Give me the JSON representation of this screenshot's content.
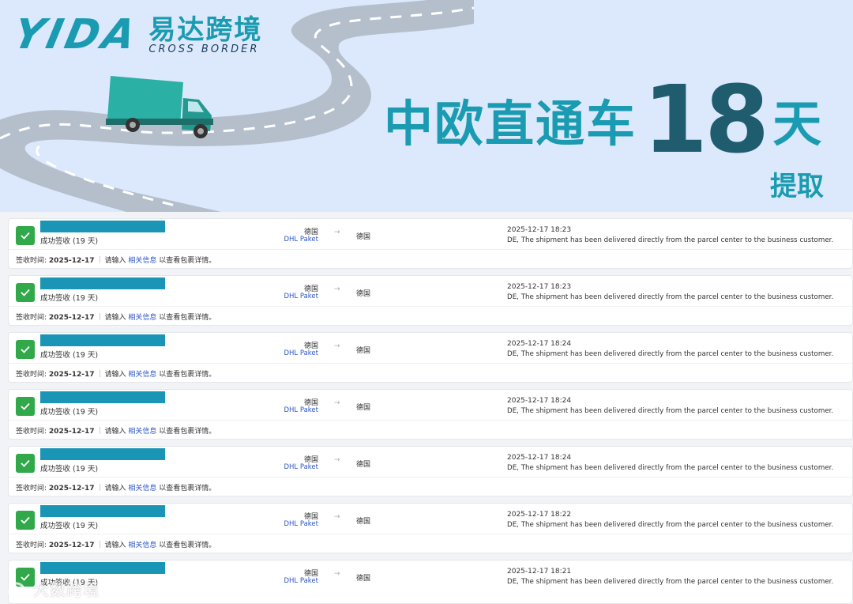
{
  "banner": {
    "logo_en": "YIDA",
    "logo_cn": "易达跨境",
    "logo_sub": "CROSS BORDER",
    "headline": "中欧直通车",
    "headline_number": "18",
    "headline_unit": "天",
    "subheadline": "提取"
  },
  "shipments": [
    {
      "status": "成功签收 (19 天)",
      "origin": "德国",
      "carrier": "DHL Paket",
      "arrow": "→",
      "destination": "德国",
      "time": "2025-12-17 18:23",
      "description": "DE, The shipment has been delivered directly from the parcel center to the business customer.",
      "footer_label": "签收时间:",
      "footer_date": "2025-12-17",
      "footer_prompt": "请输入",
      "footer_link": "相关信息",
      "footer_suffix": "以查看包裹详情。"
    },
    {
      "status": "成功签收 (19 天)",
      "origin": "德国",
      "carrier": "DHL Paket",
      "arrow": "→",
      "destination": "德国",
      "time": "2025-12-17 18:23",
      "description": "DE, The shipment has been delivered directly from the parcel center to the business customer.",
      "footer_label": "签收时间:",
      "footer_date": "2025-12-17",
      "footer_prompt": "请输入",
      "footer_link": "相关信息",
      "footer_suffix": "以查看包裹详情。"
    },
    {
      "status": "成功签收 (19 天)",
      "origin": "德国",
      "carrier": "DHL Paket",
      "arrow": "→",
      "destination": "德国",
      "time": "2025-12-17 18:24",
      "description": "DE, The shipment has been delivered directly from the parcel center to the business customer.",
      "footer_label": "签收时间:",
      "footer_date": "2025-12-17",
      "footer_prompt": "请输入",
      "footer_link": "相关信息",
      "footer_suffix": "以查看包裹详情。"
    },
    {
      "status": "成功签收 (19 天)",
      "origin": "德国",
      "carrier": "DHL Paket",
      "arrow": "→",
      "destination": "德国",
      "time": "2025-12-17 18:24",
      "description": "DE, The shipment has been delivered directly from the parcel center to the business customer.",
      "footer_label": "签收时间:",
      "footer_date": "2025-12-17",
      "footer_prompt": "请输入",
      "footer_link": "相关信息",
      "footer_suffix": "以查看包裹详情。"
    },
    {
      "status": "成功签收 (19 天)",
      "origin": "德国",
      "carrier": "DHL Paket",
      "arrow": "→",
      "destination": "德国",
      "time": "2025-12-17 18:24",
      "description": "DE, The shipment has been delivered directly from the parcel center to the business customer.",
      "footer_label": "签收时间:",
      "footer_date": "2025-12-17",
      "footer_prompt": "请输入",
      "footer_link": "相关信息",
      "footer_suffix": "以查看包裹详情。"
    },
    {
      "status": "成功签收 (19 天)",
      "origin": "德国",
      "carrier": "DHL Paket",
      "arrow": "→",
      "destination": "德国",
      "time": "2025-12-17 18:22",
      "description": "DE, The shipment has been delivered directly from the parcel center to the business customer.",
      "footer_label": "签收时间:",
      "footer_date": "2025-12-17",
      "footer_prompt": "请输入",
      "footer_link": "相关信息",
      "footer_suffix": "以查看包裹详情。"
    },
    {
      "status": "成功签收 (19 天)",
      "origin": "德国",
      "carrier": "DHL Paket",
      "arrow": "→",
      "destination": "德国",
      "time": "2025-12-17 18:21",
      "description": "DE, The shipment has been delivered directly from the parcel center to the business customer.",
      "footer_label": "",
      "footer_date": "",
      "footer_prompt": "",
      "footer_link": "",
      "footer_suffix": ""
    }
  ],
  "watermark": {
    "text": "大数跨境"
  },
  "colors": {
    "brand": "#1a9bb1",
    "success": "#31a94b",
    "link": "#2b56c6",
    "mask": "#1a95b6"
  }
}
